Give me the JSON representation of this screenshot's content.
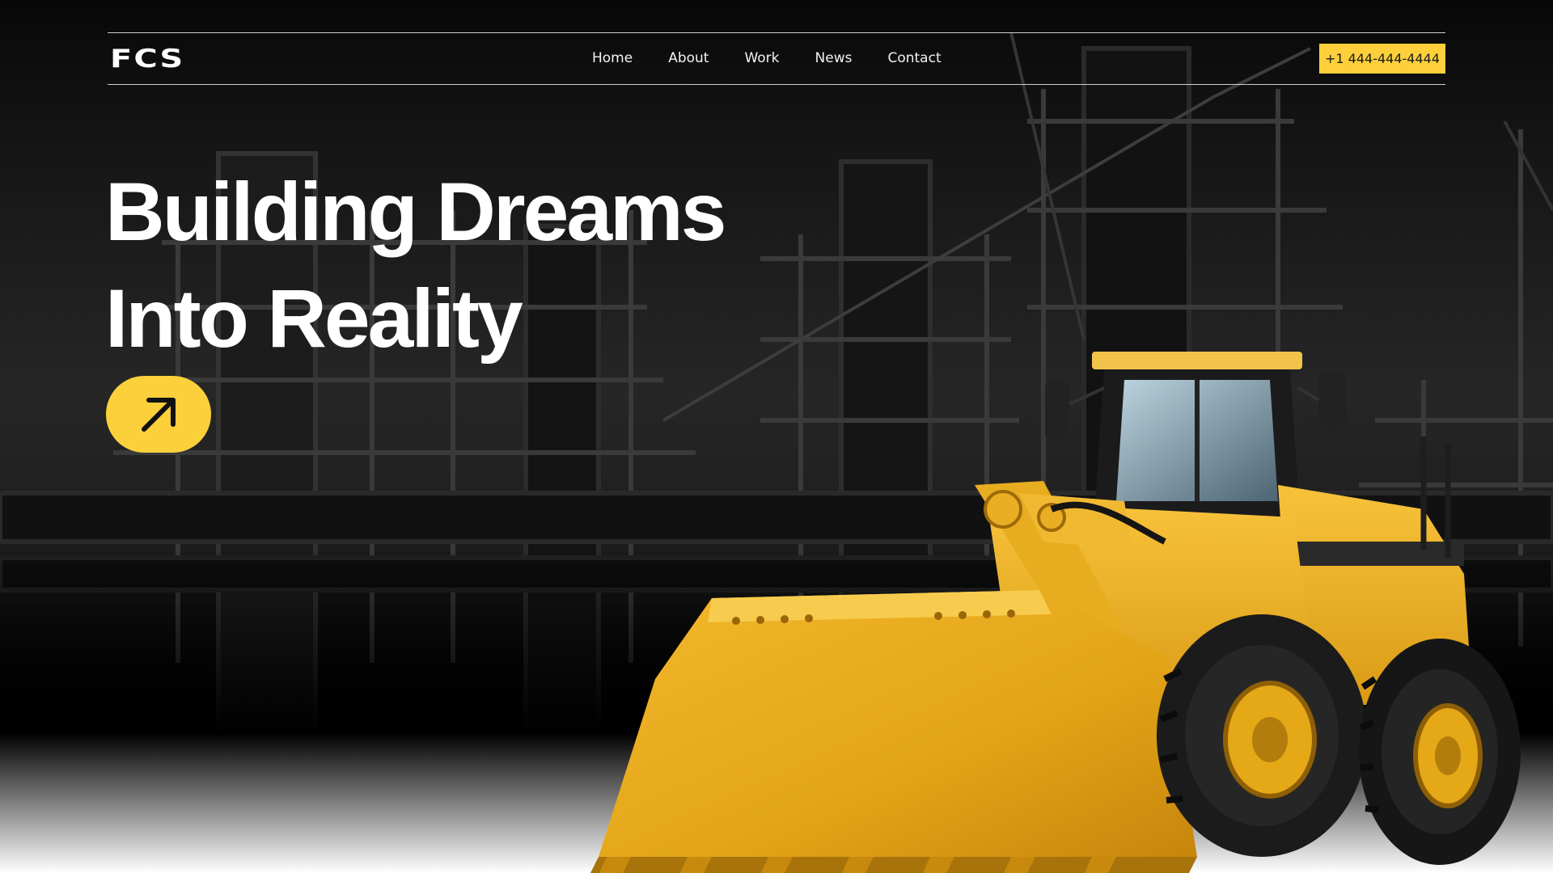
{
  "header": {
    "logo_text": "FCS",
    "nav": {
      "home": "Home",
      "about": "About",
      "work": "Work",
      "news": "News",
      "contact": "Contact"
    },
    "phone_label": "+1 444-444-4444"
  },
  "hero": {
    "headline_line1": "Building Dreams",
    "headline_line2": "Into Reality",
    "cta_icon": "arrow-up-right-icon"
  },
  "colors": {
    "accent": "#fdd03b",
    "background": "#1a1a1a",
    "text": "#ffffff"
  }
}
